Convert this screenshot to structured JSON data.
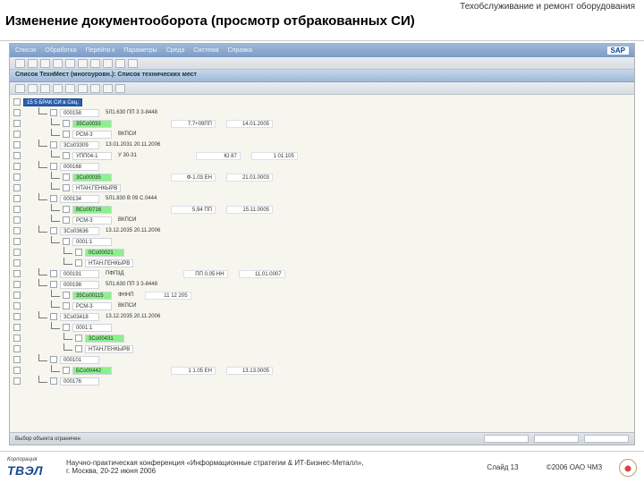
{
  "header": {
    "section": "Техобслуживание и ремонт оборудования",
    "title": "Изменение документооборота (просмотр отбракованных СИ)"
  },
  "sap": {
    "menubar": [
      "Список",
      "Обработка",
      "Перейти к",
      "Параметры",
      "Среда",
      "Система",
      "Справка"
    ],
    "logo": "SAP",
    "window_title": "Список ТехнМест (многоуровн.): Список технических мест",
    "status": "Выбор объекта ограничен"
  },
  "tree": [
    {
      "lvl": 0,
      "style": "blue",
      "code": "15 5 БРАК СИ в Сец.",
      "c1": "",
      "c2": "",
      "c3": "",
      "c4": ""
    },
    {
      "lvl": 1,
      "style": "",
      "code": "000158",
      "c1": "5Л1.630 ПП 3 3-8448",
      "c2": "",
      "c3": "",
      "c4": ""
    },
    {
      "lvl": 2,
      "style": "hl",
      "code": "35Co0033",
      "c1": "",
      "c2": "",
      "c3": "7,7+09ПП",
      "c4": "14.01.2005"
    },
    {
      "lvl": 2,
      "style": "",
      "code": "РСМ-3",
      "c1": "ВКПСИ",
      "c2": "",
      "c3": "",
      "c4": ""
    },
    {
      "lvl": 1,
      "style": "",
      "code": "3Co03309",
      "c1": "13.01.2031 20.11.2006",
      "c2": "",
      "c3": "",
      "c4": ""
    },
    {
      "lvl": 2,
      "style": "",
      "code": "УПП04-1",
      "c1": "У 30-31",
      "c2": "",
      "c3": "Ю 87",
      "c4": "1 01.105"
    },
    {
      "lvl": 1,
      "style": "",
      "code": "000168",
      "c1": "",
      "c2": "",
      "c3": "",
      "c4": ""
    },
    {
      "lvl": 2,
      "style": "hl",
      "code": "3Co00035",
      "c1": "",
      "c2": "",
      "c3": "Ф-1.03 ЕН",
      "c4": "21.01.0003"
    },
    {
      "lvl": 2,
      "style": "",
      "code": "НТАН.ГЕНКЫРВ",
      "c1": "",
      "c2": "",
      "c3": "",
      "c4": ""
    },
    {
      "lvl": 1,
      "style": "",
      "code": "000134",
      "c1": "5Л1.830 В 09 С.0444",
      "c2": "",
      "c3": "",
      "c4": ""
    },
    {
      "lvl": 2,
      "style": "hl",
      "code": "ВСо00716",
      "c1": "",
      "c2": "",
      "c3": "5,94 ПП",
      "c4": "15.11.0005"
    },
    {
      "lvl": 2,
      "style": "",
      "code": "РСМ-3",
      "c1": "ВКПСИ",
      "c2": "",
      "c3": "",
      "c4": ""
    },
    {
      "lvl": 1,
      "style": "",
      "code": "3Co03636",
      "c1": "13.12.2035 20.11.2006",
      "c2": "",
      "c3": "",
      "c4": ""
    },
    {
      "lvl": 2,
      "style": "",
      "code": "0001:1",
      "c1": "",
      "c2": "",
      "c3": "",
      "c4": ""
    },
    {
      "lvl": 3,
      "style": "hl",
      "code": "0Сo00021",
      "c1": "",
      "c2": "",
      "c3": "",
      "c4": ""
    },
    {
      "lvl": 3,
      "style": "",
      "code": "НТАН.ГЕНКЫРВ",
      "c1": "",
      "c2": "",
      "c3": "",
      "c4": ""
    },
    {
      "lvl": 1,
      "style": "",
      "code": "000191",
      "c1": "ПФП3Д",
      "c2": "",
      "c3": "ПП 0.05 НН",
      "c4": "11.01.0007"
    },
    {
      "lvl": 1,
      "style": "",
      "code": "000198",
      "c1": "5Л1.630 ПП 3 3-8448",
      "c2": "",
      "c3": "",
      "c4": ""
    },
    {
      "lvl": 2,
      "style": "hl",
      "code": "35Co00115",
      "c1": "ФННП",
      "c2": "",
      "c3": "",
      "c4": "11 12 205"
    },
    {
      "lvl": 2,
      "style": "",
      "code": "РСМ-3",
      "c1": "ВКПСИ",
      "c2": "",
      "c3": "",
      "c4": ""
    },
    {
      "lvl": 1,
      "style": "",
      "code": "3Co03418",
      "c1": "13.12.2035 20.11.2006",
      "c2": "",
      "c3": "",
      "c4": ""
    },
    {
      "lvl": 2,
      "style": "",
      "code": "0001:1",
      "c1": "",
      "c2": "",
      "c3": "",
      "c4": ""
    },
    {
      "lvl": 3,
      "style": "hl",
      "code": "3Co00431",
      "c1": "",
      "c2": "",
      "c3": "",
      "c4": ""
    },
    {
      "lvl": 3,
      "style": "",
      "code": "НТАН.ГЕНКЫРВ",
      "c1": "",
      "c2": "",
      "c3": "",
      "c4": ""
    },
    {
      "lvl": 1,
      "style": "",
      "code": "000101",
      "c1": "",
      "c2": "",
      "c3": "",
      "c4": ""
    },
    {
      "lvl": 2,
      "style": "hl",
      "code": "БСо00442",
      "c1": "",
      "c2": "",
      "c3": "1 1.05 ЕН",
      "c4": "13.13.0005"
    },
    {
      "lvl": 1,
      "style": "",
      "code": "000176",
      "c1": "",
      "c2": "",
      "c3": "",
      "c4": ""
    }
  ],
  "footer": {
    "logo_small": "Корпорация",
    "logo_big": "ТВЭЛ",
    "text1": "Научно-практическая конференция «Информационные стратегии & ИТ-Бизнес-Металл»,",
    "text2": "г. Москва, 20-22 июня 2006",
    "slide": "Слайд 13",
    "copyright": "©2006 ОАО ЧМЗ"
  }
}
